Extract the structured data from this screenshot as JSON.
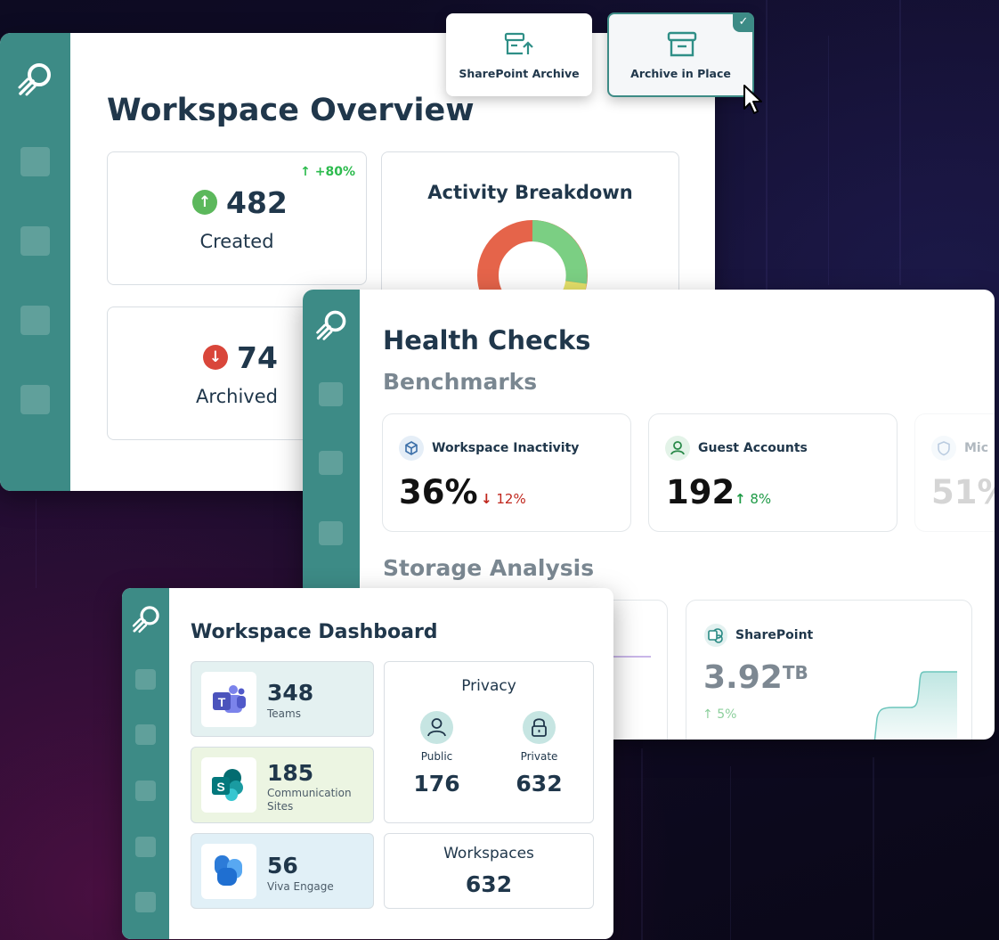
{
  "overview": {
    "title": "Workspace Overview",
    "created": {
      "value": "482",
      "label": "Created",
      "delta": "+80%"
    },
    "archived": {
      "value": "74",
      "label": "Archived"
    },
    "activity": {
      "title": "Activity Breakdown"
    }
  },
  "options": [
    {
      "label": "SharePoint Archive",
      "icon": "archive-upload-icon",
      "selected": false
    },
    {
      "label": "Archive in Place",
      "icon": "archive-box-icon",
      "selected": true
    }
  ],
  "health": {
    "title": "Health Checks",
    "benchmarks_title": "Benchmarks",
    "benchmarks": [
      {
        "label": "Workspace Inactivity",
        "value": "36%",
        "delta": "12%",
        "direction": "down",
        "icon": "cube-icon"
      },
      {
        "label": "Guest Accounts",
        "value": "192",
        "delta": "8%",
        "direction": "up",
        "icon": "user-icon"
      },
      {
        "label": "Mic",
        "value": "51%",
        "icon": "shield-icon"
      }
    ],
    "storage_title": "Storage Analysis",
    "sharepoint": {
      "label": "SharePoint",
      "value": "3.92",
      "unit": "TB",
      "delta": "5%"
    }
  },
  "dashboard": {
    "title": "Workspace Dashboard",
    "tiles": [
      {
        "value": "348",
        "label": "Teams",
        "icon": "teams-icon"
      },
      {
        "value": "185",
        "label": "Communication Sites",
        "icon": "sharepoint-icon"
      },
      {
        "value": "56",
        "label": "Viva Engage",
        "icon": "viva-engage-icon"
      }
    ],
    "privacy": {
      "title": "Privacy",
      "public_label": "Public",
      "public_value": "176",
      "private_label": "Private",
      "private_value": "632"
    },
    "workspaces": {
      "title": "Workspaces",
      "value": "632"
    }
  },
  "colors": {
    "teal": "#3d8b86",
    "green": "#2dbb4e",
    "red": "#d9463a",
    "navy": "#20374b"
  }
}
